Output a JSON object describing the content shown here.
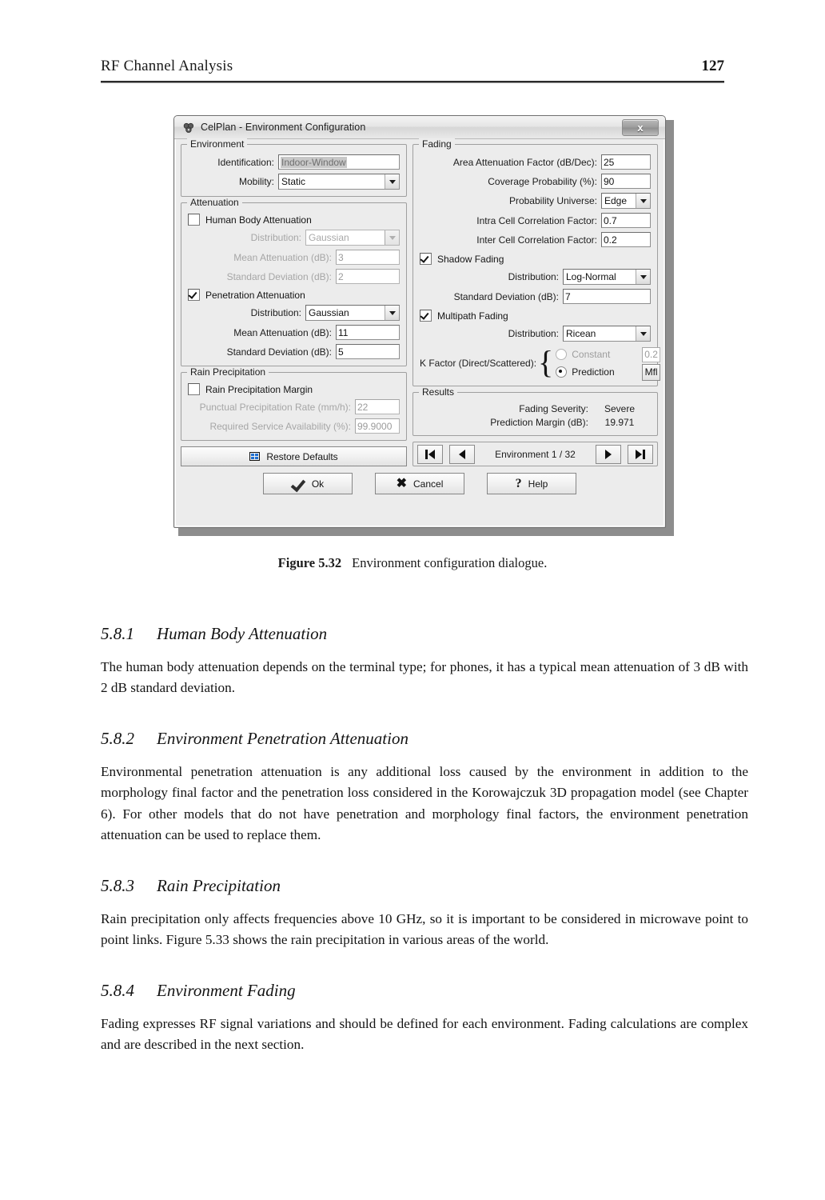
{
  "page": {
    "running_head": "RF Channel Analysis",
    "page_number": "127"
  },
  "figure": {
    "caption_label": "Figure 5.32",
    "caption_text": "Environment configuration dialogue."
  },
  "dialog": {
    "title": "CelPlan - Environment Configuration",
    "title_icon": "celplan-app-icon",
    "close_label": "x",
    "environment": {
      "group_title": "Environment",
      "identification_label": "Identification:",
      "identification_value": "Indoor-Window",
      "mobility_label": "Mobility:",
      "mobility_value": "Static"
    },
    "attenuation": {
      "group_title": "Attenuation",
      "human_body_label": "Human Body Attenuation",
      "human_body_checked": false,
      "hb_distribution_label": "Distribution:",
      "hb_distribution_value": "Gaussian",
      "hb_mean_label": "Mean Attenuation (dB):",
      "hb_mean_value": "3",
      "hb_std_label": "Standard Deviation (dB):",
      "hb_std_value": "2",
      "penetration_label": "Penetration Attenuation",
      "penetration_checked": true,
      "pen_distribution_label": "Distribution:",
      "pen_distribution_value": "Gaussian",
      "pen_mean_label": "Mean Attenuation (dB):",
      "pen_mean_value": "11",
      "pen_std_label": "Standard Deviation (dB):",
      "pen_std_value": "5"
    },
    "rain": {
      "group_title": "Rain Precipitation",
      "margin_label": "Rain Precipitation Margin",
      "margin_checked": false,
      "rate_label": "Punctual Precipitation Rate (mm/h):",
      "rate_value": "22",
      "availability_label": "Required Service Availability (%):",
      "availability_value": "99.9000"
    },
    "restore_defaults_label": "Restore Defaults",
    "restore_icon": "table-grid-icon",
    "fading": {
      "group_title": "Fading",
      "area_attenuation_label": "Area Attenuation Factor (dB/Dec):",
      "area_attenuation_value": "25",
      "coverage_probability_label": "Coverage Probability (%):",
      "coverage_probability_value": "90",
      "probability_universe_label": "Probability Universe:",
      "probability_universe_value": "Edge",
      "intra_cell_label": "Intra Cell Correlation Factor:",
      "intra_cell_value": "0.7",
      "inter_cell_label": "Inter Cell Correlation Factor:",
      "inter_cell_value": "0.2",
      "shadow_fading_label": "Shadow Fading",
      "shadow_fading_checked": true,
      "shadow_distribution_label": "Distribution:",
      "shadow_distribution_value": "Log-Normal",
      "shadow_std_label": "Standard Deviation (dB):",
      "shadow_std_value": "7",
      "multipath_label": "Multipath Fading",
      "multipath_checked": true,
      "multipath_distribution_label": "Distribution:",
      "multipath_distribution_value": "Ricean",
      "kfactor_label": "K Factor (Direct/Scattered):",
      "kfactor_constant_label": "Constant",
      "kfactor_constant_value": "0.2",
      "kfactor_constant_selected": false,
      "kfactor_prediction_label": "Prediction",
      "kfactor_prediction_selected": true,
      "kfactor_mfl_button": "Mfl"
    },
    "results": {
      "group_title": "Results",
      "severity_label": "Fading Severity:",
      "severity_value": "Severe",
      "margin_label": "Prediction Margin (dB):",
      "margin_value": "19.971"
    },
    "navigation": {
      "first_icon": "skip-to-first-icon",
      "prev_icon": "previous-icon",
      "status": "Environment 1 / 32",
      "next_icon": "next-icon",
      "last_icon": "skip-to-last-icon"
    },
    "buttons": {
      "ok_label": "Ok",
      "ok_icon": "checkmark-icon",
      "cancel_label": "Cancel",
      "cancel_icon": "x-mark-icon",
      "help_label": "Help",
      "help_icon": "question-mark-icon"
    }
  },
  "sections": [
    {
      "number": "5.8.1",
      "title": "Human Body Attenuation",
      "body": "The human body attenuation depends on the terminal type; for phones, it has a typical mean attenuation of 3 dB with 2 dB standard deviation."
    },
    {
      "number": "5.8.2",
      "title": "Environment Penetration Attenuation",
      "body": "Environmental penetration attenuation is any additional loss caused by the environment in addition to the morphology final factor and the penetration loss considered in the Korowajczuk 3D propagation model (see Chapter 6). For other models that do not have penetration and morphology final factors, the environment penetration attenuation can be used to replace them."
    },
    {
      "number": "5.8.3",
      "title": "Rain Precipitation",
      "body": "Rain precipitation only affects frequencies above 10 GHz, so it is important to be considered in microwave point to point links. Figure 5.33 shows the rain precipitation in various areas of the world."
    },
    {
      "number": "5.8.4",
      "title": "Environment Fading",
      "body": "Fading expresses RF signal variations and should be defined for each environment. Fading calculations are complex and are described in the next section."
    }
  ]
}
